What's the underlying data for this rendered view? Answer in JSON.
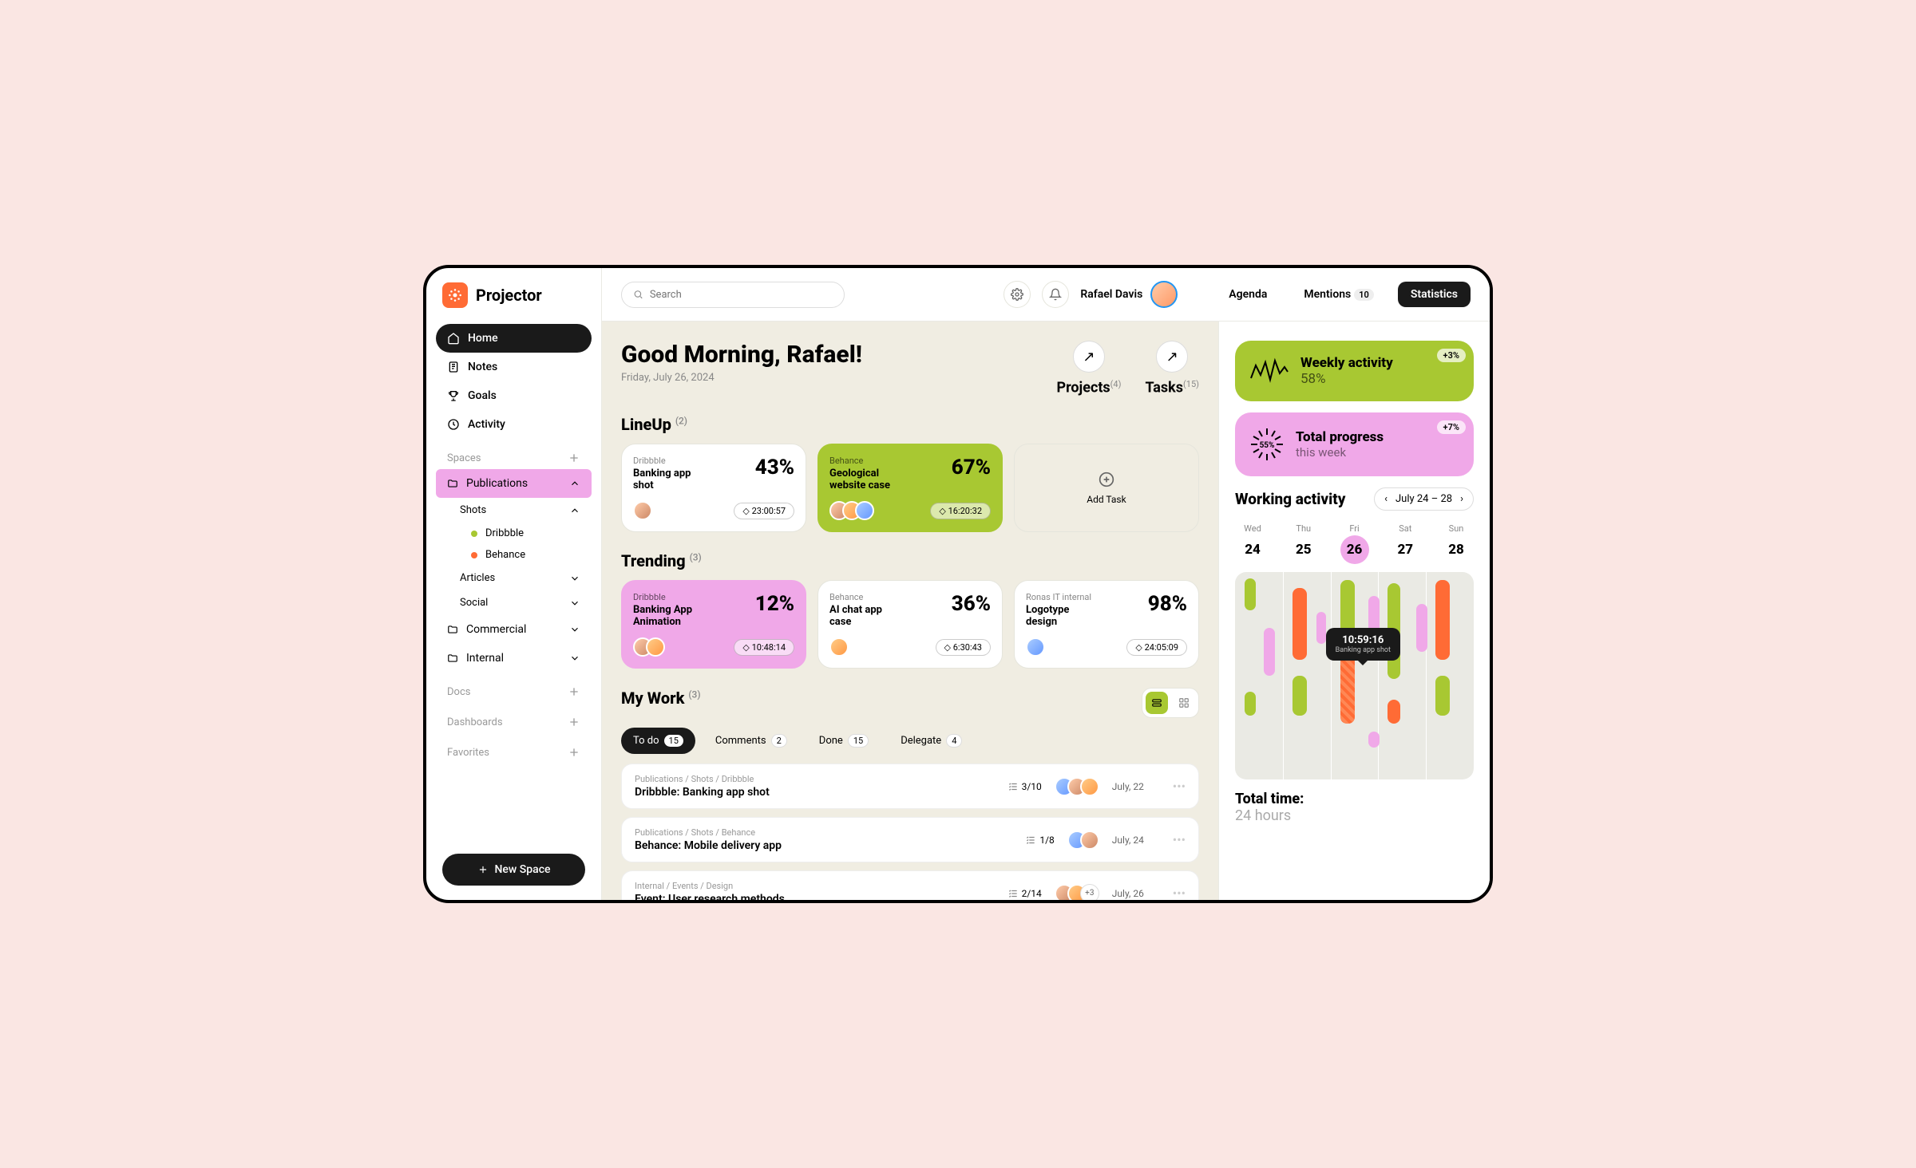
{
  "app": {
    "name": "Projector"
  },
  "search": {
    "placeholder": "Search"
  },
  "user": {
    "name": "Rafael Davis"
  },
  "topTabs": {
    "agenda": "Agenda",
    "mentions": "Mentions",
    "mentionsCount": "10",
    "statistics": "Statistics"
  },
  "sidebar": {
    "nav": {
      "home": "Home",
      "notes": "Notes",
      "goals": "Goals",
      "activity": "Activity"
    },
    "spaces": "Spaces",
    "publications": "Publications",
    "shots": "Shots",
    "dribbble": "Dribbble",
    "behance": "Behance",
    "articles": "Articles",
    "social": "Social",
    "commercial": "Commercial",
    "internal": "Internal",
    "docs": "Docs",
    "dashboards": "Dashboards",
    "favorites": "Favorites",
    "newSpace": "New Space"
  },
  "greeting": {
    "title": "Good Morning, Rafael!",
    "date": "Friday, July 26, 2024"
  },
  "quickStats": {
    "projects": {
      "label": "Projects",
      "count": "(4)"
    },
    "tasks": {
      "label": "Tasks",
      "count": "(15)"
    }
  },
  "lineup": {
    "title": "LineUp",
    "count": "(2)",
    "cards": [
      {
        "source": "Dribbble",
        "title": "Banking app shot",
        "pct": "43%",
        "timer": "23:00:57"
      },
      {
        "source": "Behance",
        "title": "Geological website case",
        "pct": "67%",
        "timer": "16:20:32"
      }
    ],
    "addTask": "Add Task"
  },
  "trending": {
    "title": "Trending",
    "count": "(3)",
    "cards": [
      {
        "source": "Dribbble",
        "title": "Banking App Animation",
        "pct": "12%",
        "timer": "10:48:14"
      },
      {
        "source": "Behance",
        "title": "AI chat app case",
        "pct": "36%",
        "timer": "6:30:43"
      },
      {
        "source": "Ronas IT internal",
        "title": "Logotype design",
        "pct": "98%",
        "timer": "24:05:09"
      }
    ]
  },
  "mywork": {
    "title": "My Work",
    "count": "(3)",
    "tabs": {
      "todo": "To do",
      "todoCount": "15",
      "comments": "Comments",
      "commentsCount": "2",
      "done": "Done",
      "doneCount": "15",
      "delegate": "Delegate",
      "delegateCount": "4"
    },
    "tasks": [
      {
        "crumbs": "Publications / Shots / Dribbble",
        "title": "Dribbble: Banking app shot",
        "progress": "3/10",
        "date": "July, 22",
        "extra": ""
      },
      {
        "crumbs": "Publications / Shots / Behance",
        "title": "Behance: Mobile delivery app",
        "progress": "1/8",
        "date": "July, 24",
        "extra": ""
      },
      {
        "crumbs": "Internal / Events / Design",
        "title": "Event: User research methods",
        "progress": "2/14",
        "date": "July, 26",
        "extra": "+3"
      }
    ]
  },
  "rightStats": {
    "weekly": {
      "title": "Weekly activity",
      "value": "58%",
      "delta": "+3%"
    },
    "progress": {
      "title": "Total progress",
      "sub": "this week",
      "value": "55%",
      "delta": "+7%"
    }
  },
  "workingActivity": {
    "title": "Working activity",
    "range": "July 24 – 28",
    "days": [
      {
        "name": "Wed",
        "num": "24"
      },
      {
        "name": "Thu",
        "num": "25"
      },
      {
        "name": "Fri",
        "num": "26"
      },
      {
        "name": "Sat",
        "num": "27"
      },
      {
        "name": "Sun",
        "num": "28"
      }
    ],
    "tooltip": {
      "time": "10:59:16",
      "label": "Banking app shot"
    },
    "totalLabel": "Total time:",
    "totalValue": "24 hours"
  }
}
